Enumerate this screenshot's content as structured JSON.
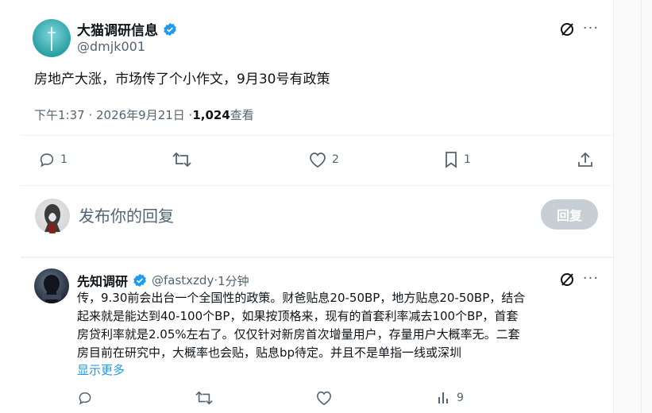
{
  "tweet": {
    "display_name": "大猫调研信息",
    "handle": "@dmjk001",
    "text": "房地产大涨，市场传了个小作文，9月30号有政策",
    "time": "下午1:37 · 2026年9月21日 · ",
    "views_count": "1,024",
    "views_label": " 查看",
    "actions": {
      "replies": "1",
      "likes": "2",
      "bookmarks": "1"
    }
  },
  "composer": {
    "placeholder": "发布你的回复",
    "reply_button": "回复"
  },
  "reply": {
    "display_name": "先知调研",
    "handle": "@fastxzdy",
    "separator": " · ",
    "time": "1分钟",
    "text_lines": [
      "传，9.30前会出台一个全国性的政策。财爸贴息20-50BP，地方贴息20-50BP，结合",
      "起来就是能达到40-100个BP，如果按顶格来，现有的首套利率减去100个BP，首套",
      "房贷利率就是2.05%左右了。仅仅针对新房首次增量用户，存量用户大概率无。二套",
      "房目前在研究中，大概率也会贴，贴息bp待定。并且不是单指一线或深圳"
    ],
    "show_more": "显示更多",
    "actions": {
      "views": "9"
    }
  },
  "colors": {
    "verified": "#1d9bf0",
    "link": "#1d9bf0",
    "muted": "#536471"
  },
  "icons": [
    "grok-icon",
    "more-icon",
    "reply-icon",
    "retweet-icon",
    "like-icon",
    "bookmark-icon",
    "share-icon",
    "views-icon",
    "verified-badge-icon"
  ]
}
